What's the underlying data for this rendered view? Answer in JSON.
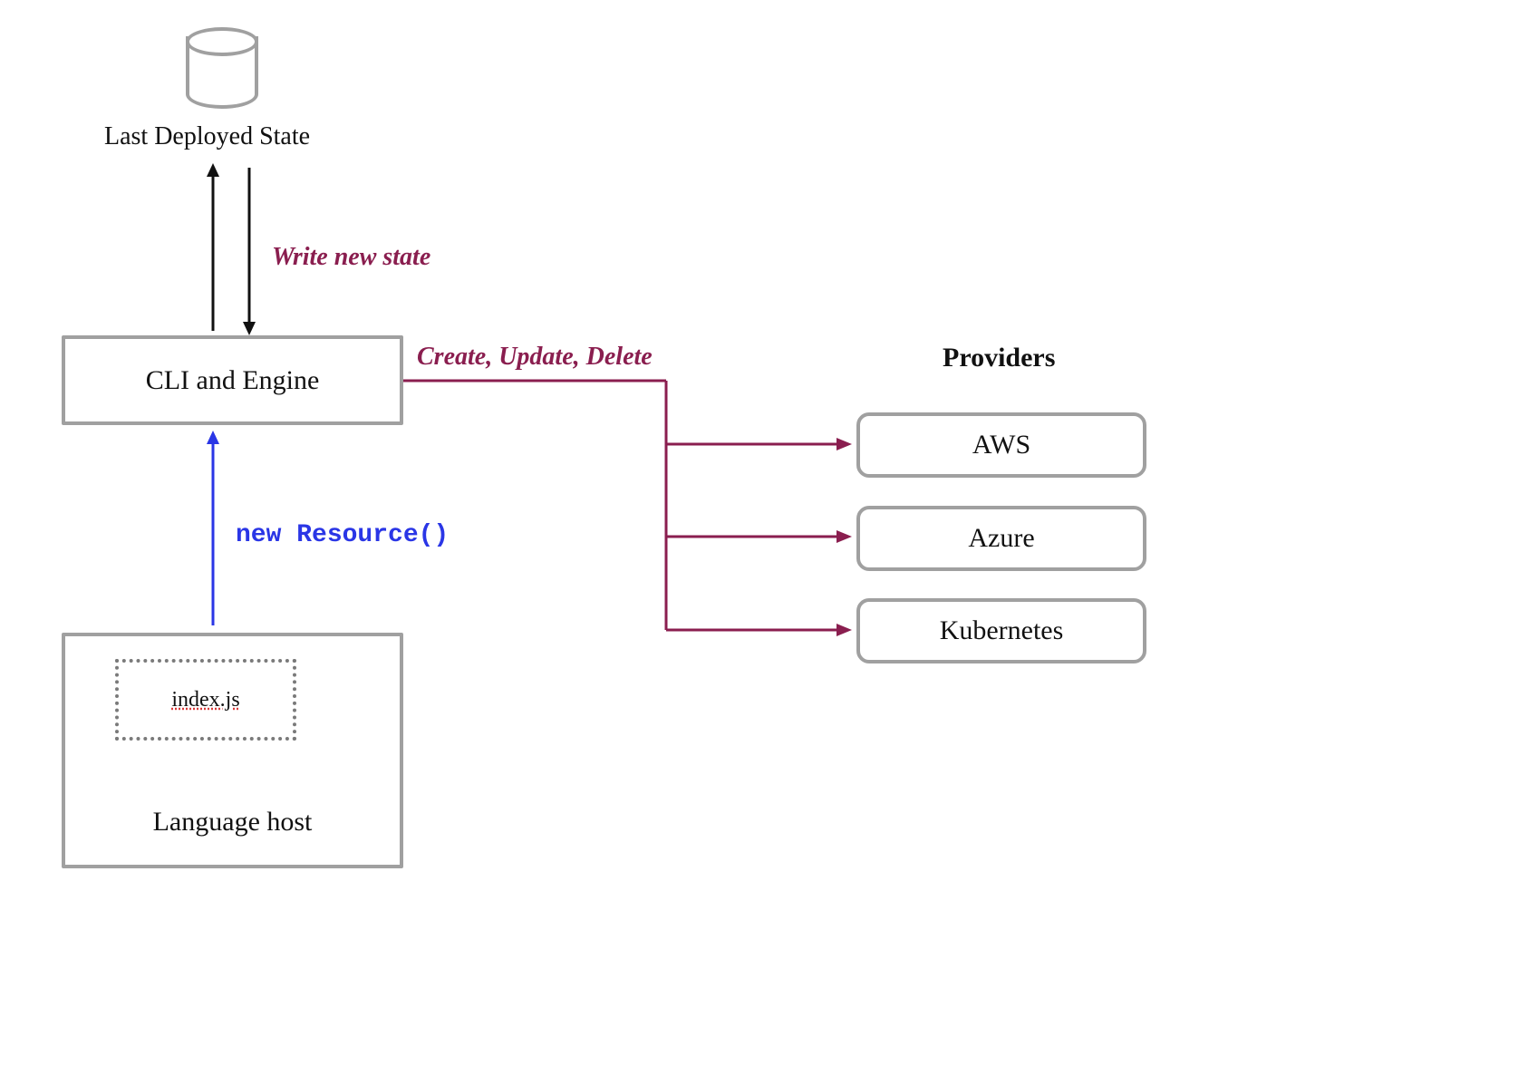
{
  "state": {
    "caption": "Last Deployed State",
    "arrow_label": "Write new state"
  },
  "engine": {
    "label": "CLI and Engine",
    "crud_label": "Create, Update, Delete"
  },
  "language_host": {
    "label": "Language host",
    "file_label": "index.js",
    "arrow_label": "new Resource()"
  },
  "providers": {
    "heading": "Providers",
    "items": [
      "AWS",
      "Azure",
      "Kubernetes"
    ]
  }
}
